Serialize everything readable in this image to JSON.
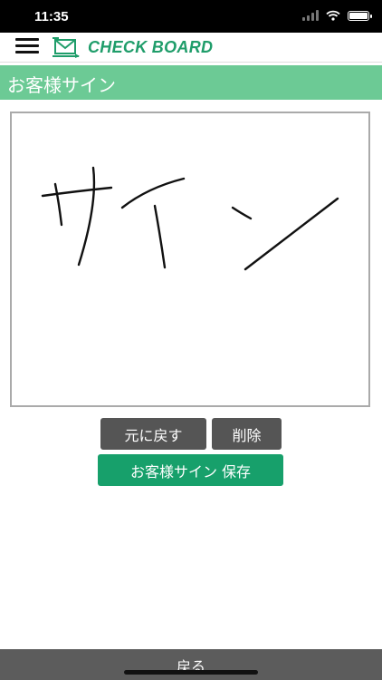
{
  "status": {
    "time": "11:35"
  },
  "header": {
    "logo_text": "CHECK BOARD"
  },
  "page": {
    "title": "お客様サイン"
  },
  "signature": {
    "handwritten_text": "サイン"
  },
  "actions": {
    "undo_label": "元に戻す",
    "delete_label": "削除",
    "save_label": "お客様サイン 保存"
  },
  "footer": {
    "back_label": "戻る"
  },
  "colors": {
    "title_bar": "#6cca95",
    "brand": "#1f9d6a",
    "save_button": "#17a06b",
    "gray_button": "#555555"
  }
}
